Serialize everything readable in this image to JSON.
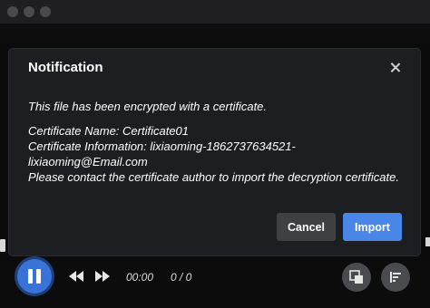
{
  "dialog": {
    "title": "Notification",
    "message_intro": "This file has been encrypted with a certificate.",
    "cert_name_line": "Certificate Name: Certificate01",
    "cert_info_line": "Certificate Information: lixiaoming-1862737634521-lixiaoming@Email.com",
    "instruction": "Please contact the certificate author to import the decryption certificate.",
    "cancel_label": "Cancel",
    "import_label": "Import"
  },
  "player": {
    "time": "00:00",
    "count": "0 / 0"
  },
  "colors": {
    "accent": "#4a86e8",
    "dialog_bg": "#1d1e21",
    "cancel_bg": "#3f4044"
  },
  "icons": [
    "close-icon",
    "pause-icon",
    "rewind-icon",
    "fast-forward-icon",
    "picture-in-picture-icon",
    "playlist-icon"
  ]
}
